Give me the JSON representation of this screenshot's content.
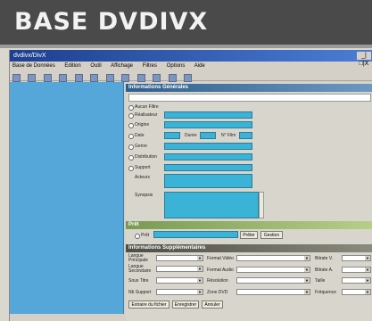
{
  "banner": {
    "title": "BASE DVDIVX"
  },
  "window": {
    "title": "dvdivx/DivX",
    "controls": "_|□|X",
    "menu": [
      "Base de Données",
      "Edition",
      "Outil",
      "Affichage",
      "Filtres",
      "Options",
      "Aide"
    ]
  },
  "info": {
    "header": "Informations Générales",
    "fields": [
      {
        "label": "Aucun Filtre"
      },
      {
        "label": "Réalisateur"
      },
      {
        "label": "Origine"
      },
      {
        "label": "Date"
      },
      {
        "label": "Genre"
      },
      {
        "label": "Distribution"
      },
      {
        "label": "Support"
      }
    ],
    "duree_label": "Durée",
    "nfilm_label": "N° Film",
    "acteurs_label": "Acteurs",
    "synopsis_label": "Synopsis"
  },
  "pret": {
    "header": "Prêt",
    "label": "Prêt",
    "btn_pret": "Prêter",
    "btn_gestion": "Gestion"
  },
  "supp": {
    "header": "Informations Supplémentaires",
    "col1": [
      "Langue Principale",
      "Langue Secondaire",
      "Sous Titre",
      "Nb Support"
    ],
    "col2": [
      "Format Vidéo",
      "Format Audio",
      "Résolution",
      "Zone DVD"
    ],
    "col3": [
      "Bitrate V.",
      "Bitrate A.",
      "Taille",
      "Fréquence"
    ]
  },
  "buttons": {
    "extract": "Extraire du fichier",
    "save": "Enregistrer",
    "cancel": "Annuler"
  }
}
